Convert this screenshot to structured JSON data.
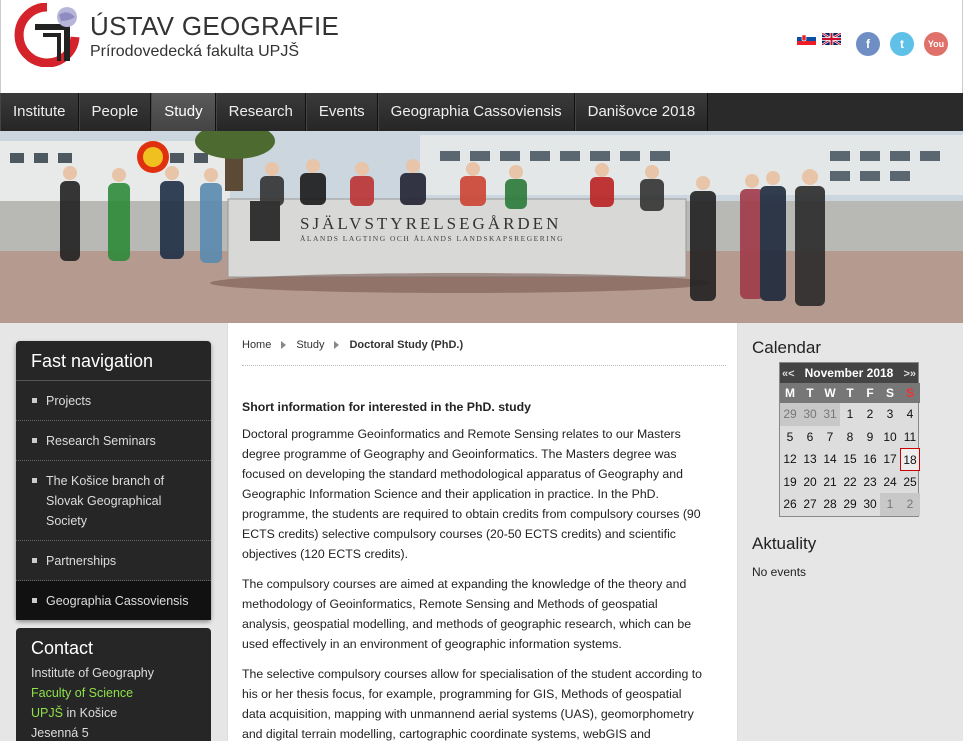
{
  "header": {
    "title": "ÚSTAV GEOGRAFIE",
    "subtitle": "Prírodovedecká fakulta UPJŠ"
  },
  "social": {
    "facebook": "f",
    "twitter": "t",
    "youtube": "You"
  },
  "nav": {
    "items": [
      {
        "label": "Institute"
      },
      {
        "label": "People"
      },
      {
        "label": "Study"
      },
      {
        "label": "Research"
      },
      {
        "label": "Events"
      },
      {
        "label": "Geographia Cassoviensis"
      },
      {
        "label": "Danišovce 2018"
      }
    ],
    "active": "Study"
  },
  "banner": {
    "sign_line1": "SJÄLVSTYRELSEGÅRDEN",
    "sign_line2": "ÅLANDS LAGTING OCH ÅLANDS LANDSKAPSREGERING"
  },
  "fastnav": {
    "title": "Fast navigation",
    "items": [
      {
        "label": "Projects"
      },
      {
        "label": "Research Seminars"
      },
      {
        "label": "The Košice branch of Slovak Geographical Society"
      },
      {
        "label": "Partnerships"
      },
      {
        "label": "Geographia Cassoviensis"
      }
    ]
  },
  "contact": {
    "title": "Contact",
    "line1": "Institute of Geography",
    "line2": "Faculty of Science",
    "line3a": "UPJŠ",
    "line3b": "in Košice",
    "line4": "Jesenná 5"
  },
  "breadcrumb": {
    "home": "Home",
    "study": "Study",
    "current": "Doctoral Study (PhD.)"
  },
  "content": {
    "heading": "Short information for interested in the PhD. study",
    "p1": "Doctoral programme Geoinformatics and Remote Sensing relates to our Masters degree programme of Geography and Geoinformatics. The Masters degree was focused on developing the standard methodological apparatus of Geography and Geographic Information Science and their application in practice. In the PhD. programme, the students are required to obtain credits from compulsory courses (90 ECTS credits) selective compulsory courses (20-50 ECTS credits) and scientific objectives (120 ECTS credits).",
    "p2": "The compulsory courses are aimed at expanding the knowledge of the theory and methodology of Geoinformatics, Remote Sensing and Methods of geospatial analysis, geospatial modelling, and methods of geographic research, which can be used effectively in an environment of geographic information systems.",
    "p3": "The selective compulsory courses allow for specialisation of the student according to his or her thesis focus, for example, programming for GIS, Methods of geospatial data acquisition, mapping with unmannend aerial systems (UAS), geomorphometry and digital terrain modelling, cartographic coordinate systems, webGIS and"
  },
  "calendar": {
    "title": "Calendar",
    "prev_year": "«",
    "prev_month": "<",
    "month_label": "November 2018",
    "next_month": ">",
    "next_year": "»",
    "dow": [
      "M",
      "T",
      "W",
      "T",
      "F",
      "S",
      "S"
    ],
    "days": [
      {
        "d": "29",
        "other": true
      },
      {
        "d": "30",
        "other": true
      },
      {
        "d": "31",
        "other": true
      },
      {
        "d": "1"
      },
      {
        "d": "2"
      },
      {
        "d": "3"
      },
      {
        "d": "4"
      },
      {
        "d": "5"
      },
      {
        "d": "6"
      },
      {
        "d": "7"
      },
      {
        "d": "8"
      },
      {
        "d": "9"
      },
      {
        "d": "10"
      },
      {
        "d": "11"
      },
      {
        "d": "12"
      },
      {
        "d": "13"
      },
      {
        "d": "14"
      },
      {
        "d": "15"
      },
      {
        "d": "16"
      },
      {
        "d": "17"
      },
      {
        "d": "18",
        "today": true
      },
      {
        "d": "19"
      },
      {
        "d": "20"
      },
      {
        "d": "21"
      },
      {
        "d": "22"
      },
      {
        "d": "23"
      },
      {
        "d": "24"
      },
      {
        "d": "25"
      },
      {
        "d": "26"
      },
      {
        "d": "27"
      },
      {
        "d": "28"
      },
      {
        "d": "29"
      },
      {
        "d": "30"
      },
      {
        "d": "1",
        "other": true
      },
      {
        "d": "2",
        "other": true
      }
    ]
  },
  "news": {
    "title": "Aktuality",
    "empty": "No events"
  },
  "colors": {
    "nav_bg": "#2a2a2a",
    "accent_green": "#8fe04a",
    "logo_red": "#d4232a"
  }
}
